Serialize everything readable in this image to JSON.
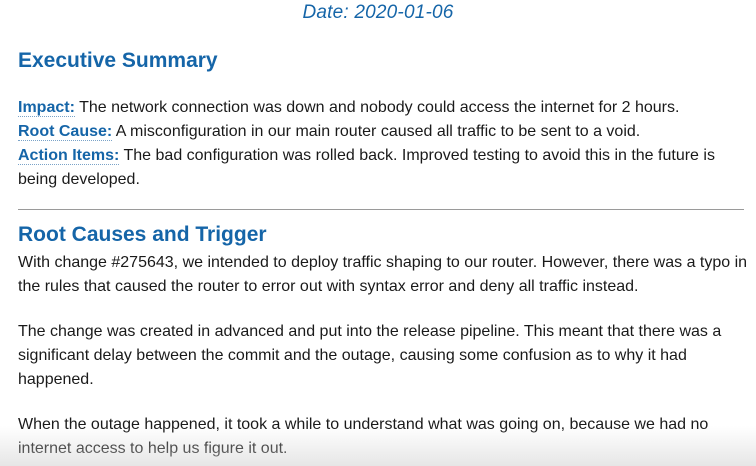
{
  "date": "Date: 2020-01-06",
  "executive_summary": {
    "heading": "Executive Summary",
    "impact_label": "Impact:",
    "impact_text": " The network connection was down and nobody could access the internet for 2 hours.",
    "root_cause_label": "Root Cause:",
    "root_cause_text": " A misconfiguration in our main router caused all traffic to be sent to a void.",
    "action_items_label": "Action Items:",
    "action_items_text": " The bad configuration was rolled back. Improved testing to avoid this in the future is being developed."
  },
  "root_causes": {
    "heading": "Root Causes and Trigger",
    "paragraph1": "With change #275643, we intended to deploy traffic shaping to our router. However, there was a typo in the rules that caused the router to error out with syntax error and deny all traffic instead.",
    "paragraph2": "The change was created in advanced and put into the release pipeline. This meant that there was a significant delay between the commit and the outage, causing some confusion as to why it had happened.",
    "paragraph3": "When the outage happened, it took a while to understand what was going on, because we had no internet access to help us figure it out."
  }
}
